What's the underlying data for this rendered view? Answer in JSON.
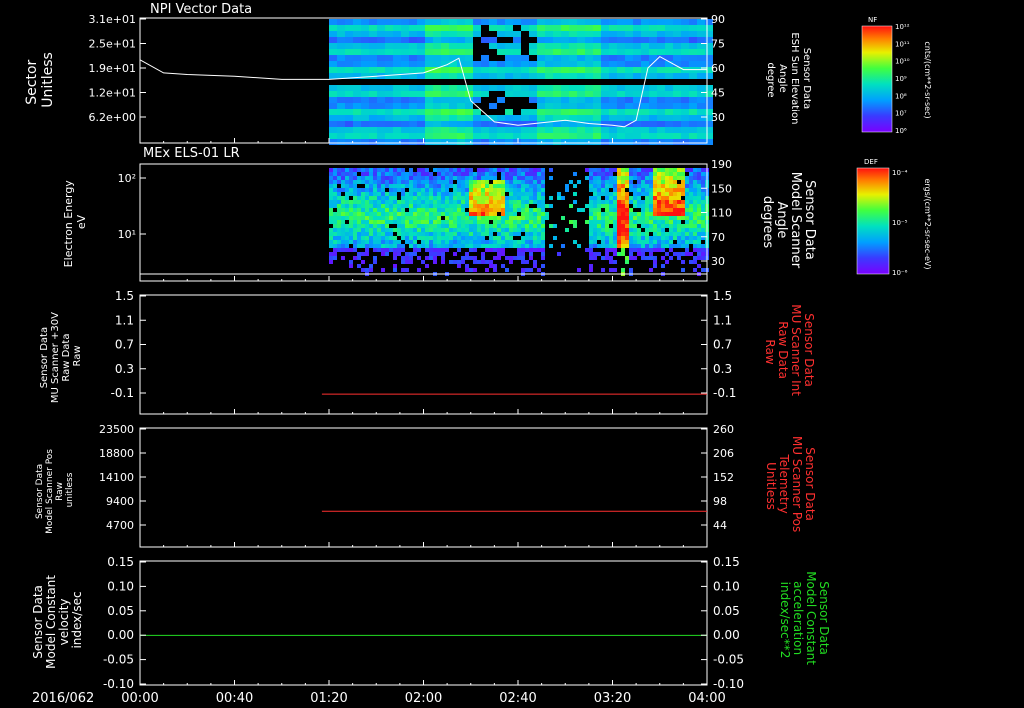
{
  "date_label": "2016/062",
  "time_ticks": [
    "00:00",
    "00:40",
    "01:20",
    "02:00",
    "02:40",
    "03:20",
    "04:00"
  ],
  "colors": {
    "axis": "#ffffff",
    "red_trace": "#ff3030",
    "green_trace": "#22dd22",
    "elev_line": "#ffffff"
  },
  "panels": [
    {
      "id": "npi",
      "title": "NPI Vector Data",
      "left_label": [
        "Sector",
        "Unitless"
      ],
      "left_ticks": [
        "3.1e+01",
        "2.5e+01",
        "1.9e+01",
        "1.2e+01",
        "6.2e+00"
      ],
      "right_label": [
        "Sensor Data",
        "ESH Sun Elevation",
        "Angle",
        "degree"
      ],
      "right_ticks": [
        "90",
        "75",
        "60",
        "45",
        "30"
      ],
      "colorbar": {
        "label": "NF",
        "units": "cnts/(cm**2-sr-sec)",
        "ticks": [
          "10¹²",
          "10¹¹",
          "10¹⁰",
          "10⁹",
          "10⁸",
          "10⁷",
          "10⁶"
        ]
      }
    },
    {
      "id": "els",
      "title": "MEx ELS-01 LR",
      "left_label": [
        "Electron Energy",
        "eV"
      ],
      "left_ticks": [
        "10²",
        "10¹"
      ],
      "right_label": [
        "Sensor Data",
        "Model Scanner",
        "Angle",
        "degrees"
      ],
      "right_ticks": [
        "190",
        "150",
        "110",
        "70",
        "30"
      ],
      "colorbar": {
        "label": "DEF",
        "units": "ergs/(cm**2-sr-sec-eV)",
        "ticks": [
          "10⁻⁴",
          "10⁻⁵",
          "10⁻⁶"
        ]
      }
    },
    {
      "id": "mu_raw",
      "left_label": [
        "Sensor Data",
        "MU Scanner +30V",
        "Raw Data",
        "Raw"
      ],
      "left_ticks": [
        "1.5",
        "1.1",
        "0.7",
        "0.3",
        "-0.1"
      ],
      "right_label": [
        "Sensor Data",
        "MU Scanner Int",
        "Raw Data",
        "Raw"
      ],
      "right_ticks": [
        "1.5",
        "1.1",
        "0.7",
        "0.3",
        "-0.1"
      ]
    },
    {
      "id": "mu_pos",
      "left_label": [
        "Sensor Data",
        "Model Scanner Pos",
        "Raw",
        "unitless"
      ],
      "left_ticks": [
        "23500",
        "18800",
        "14100",
        "9400",
        "4700"
      ],
      "right_label": [
        "Sensor Data",
        "MU Scanner Pos",
        "Telemetry",
        "Unitless"
      ],
      "right_ticks": [
        "260",
        "206",
        "152",
        "98",
        "44"
      ]
    },
    {
      "id": "model_const",
      "left_label": [
        "Sensor Data",
        "Model Constant",
        "velocity",
        "index/sec"
      ],
      "left_ticks": [
        "0.15",
        "0.10",
        "0.05",
        "0.00",
        "-0.05",
        "-0.10"
      ],
      "right_label": [
        "Sensor Data",
        "Model Constant",
        "acceleration",
        "index/sec**2"
      ],
      "right_ticks": [
        "0.15",
        "0.10",
        "0.05",
        "0.00",
        "-0.05",
        "-0.10"
      ]
    }
  ],
  "chart_data": [
    {
      "type": "heatmap",
      "title": "NPI Vector Data",
      "ylabel": "Sector Unitless",
      "y2label": "Sensor Data ESH Sun Elevation Angle degree",
      "xlim": [
        "00:00",
        "04:00"
      ],
      "data_start": "01:20",
      "series": [
        {
          "name": "ESH Sun Elevation Angle",
          "x": [
            "00:00",
            "00:10",
            "00:20",
            "00:40",
            "01:00",
            "01:20",
            "01:40",
            "02:00",
            "02:10",
            "02:15",
            "02:20",
            "02:30",
            "02:40",
            "03:00",
            "03:10",
            "03:20",
            "03:25",
            "03:30",
            "03:35",
            "03:40",
            "03:50",
            "04:00"
          ],
          "values": [
            65,
            57,
            56,
            55,
            53,
            53,
            55,
            57,
            62,
            66,
            40,
            27,
            25,
            28,
            26,
            25,
            24,
            28,
            60,
            67,
            59,
            59
          ]
        }
      ],
      "ylim": [
        18,
        90
      ]
    },
    {
      "type": "heatmap",
      "title": "MEx ELS-01 LR",
      "ylabel": "Electron Energy eV",
      "y2label": "Sensor Data Model Scanner Angle degrees",
      "xlim": [
        "00:00",
        "04:00"
      ],
      "data_start": "01:20",
      "yscale": "log"
    },
    {
      "type": "line",
      "ylabel": "Sensor Data MU Scanner +30V Raw Data Raw",
      "y2label": "Sensor Data MU Scanner Int Raw Data Raw",
      "ylim": [
        -0.3,
        1.5
      ],
      "series": [
        {
          "x": [
            "01:17",
            "04:00"
          ],
          "values": [
            0.0,
            0.0
          ]
        }
      ]
    },
    {
      "type": "line",
      "ylabel": "Sensor Data Model Scanner Pos Raw unitless",
      "y2label": "Sensor Data MU Scanner Pos Telemetry Unitless",
      "ylim": [
        0,
        23500
      ],
      "series": [
        {
          "x": [
            "01:17",
            "04:00"
          ],
          "values": [
            7050,
            7050
          ]
        }
      ]
    },
    {
      "type": "line",
      "ylabel": "Sensor Data Model Constant velocity index/sec",
      "y2label": "Sensor Data Model Constant acceleration index/sec**2",
      "ylim": [
        -0.1,
        0.15
      ],
      "series": [
        {
          "x": [
            "00:00",
            "04:00"
          ],
          "values": [
            0.0,
            0.0
          ]
        }
      ]
    }
  ]
}
